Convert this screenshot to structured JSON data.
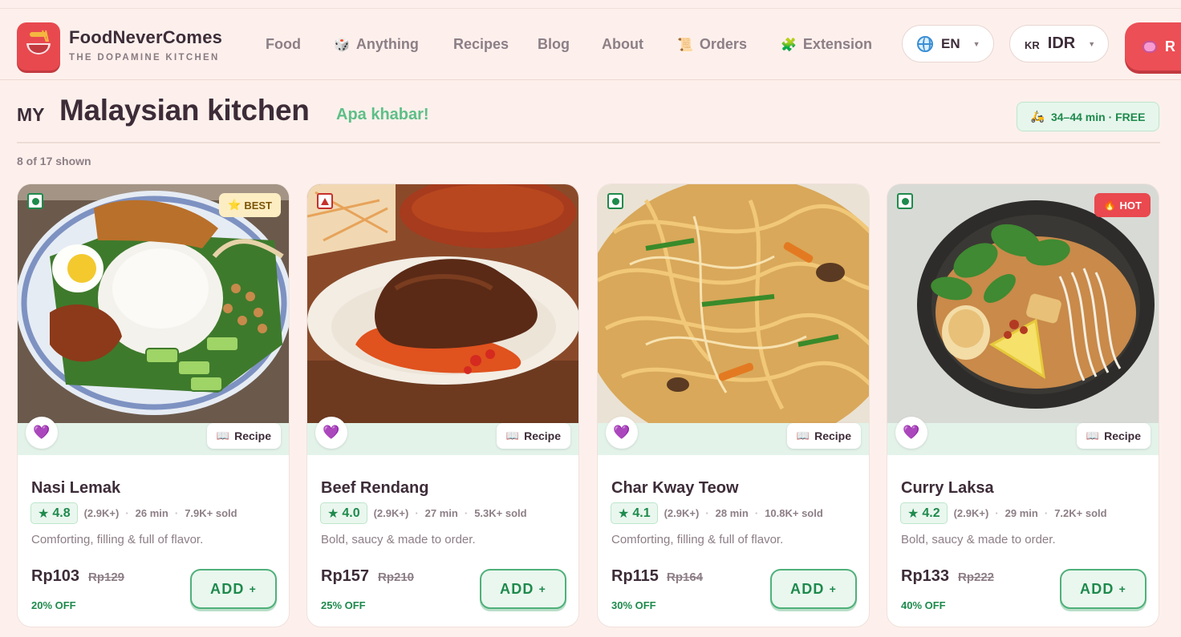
{
  "brand": {
    "name": "FoodNeverComes",
    "tagline": "THE DOPAMINE KITCHEN"
  },
  "nav": [
    {
      "label": "Food",
      "icon": ""
    },
    {
      "label": "Anything",
      "icon": "dice-icon"
    },
    {
      "label": "Recipes",
      "icon": ""
    },
    {
      "label": "Blog",
      "icon": ""
    },
    {
      "label": "About",
      "icon": ""
    },
    {
      "label": "Orders",
      "icon": "scroll-icon"
    },
    {
      "label": "Extension",
      "icon": "puzzle-icon"
    }
  ],
  "language": {
    "value": "EN",
    "icon": "globe-icon"
  },
  "currency": {
    "prefix": "KR",
    "value": "IDR"
  },
  "cta": {
    "label": "R"
  },
  "page": {
    "flag_code": "MY",
    "title": "Malaysian kitchen",
    "greeting": "Apa khabar!",
    "delivery": "34–44 min · FREE",
    "count": "8 of 17 shown"
  },
  "colors": {
    "accent": "#e8494f",
    "green": "#1e8a4c",
    "background": "#fdf0ec"
  },
  "cards": [
    {
      "name": "Nasi Lemak",
      "veg": true,
      "badge": "BEST",
      "badge_type": "best",
      "rating": "4.8",
      "reviews": "(2.9K+)",
      "time": "26 min",
      "sold": "7.9K+ sold",
      "tagline": "Comforting, filling & full of flavor.",
      "price": "Rp103",
      "old_price": "Rp129",
      "discount": "20% OFF",
      "recipe_label": "Recipe",
      "add_label": "ADD"
    },
    {
      "name": "Beef Rendang",
      "veg": false,
      "badge": "",
      "badge_type": "",
      "rating": "4.0",
      "reviews": "(2.9K+)",
      "time": "27 min",
      "sold": "5.3K+ sold",
      "tagline": "Bold, saucy & made to order.",
      "price": "Rp157",
      "old_price": "Rp210",
      "discount": "25% OFF",
      "recipe_label": "Recipe",
      "add_label": "ADD"
    },
    {
      "name": "Char Kway Teow",
      "veg": true,
      "badge": "",
      "badge_type": "",
      "rating": "4.1",
      "reviews": "(2.9K+)",
      "time": "28 min",
      "sold": "10.8K+ sold",
      "tagline": "Comforting, filling & full of flavor.",
      "price": "Rp115",
      "old_price": "Rp164",
      "discount": "30% OFF",
      "recipe_label": "Recipe",
      "add_label": "ADD"
    },
    {
      "name": "Curry Laksa",
      "veg": true,
      "badge": "HOT",
      "badge_type": "hot",
      "rating": "4.2",
      "reviews": "(2.9K+)",
      "time": "29 min",
      "sold": "7.2K+ sold",
      "tagline": "Bold, saucy & made to order.",
      "price": "Rp133",
      "old_price": "Rp222",
      "discount": "40% OFF",
      "recipe_label": "Recipe",
      "add_label": "ADD"
    }
  ]
}
